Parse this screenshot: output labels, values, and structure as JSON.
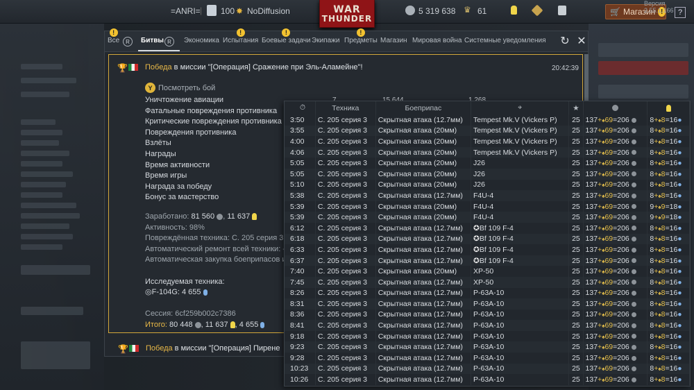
{
  "topbar": {
    "squad_tag": "=ANRI=",
    "level": "100",
    "nickname": "NoDiffusion",
    "logo_line1": "WAR",
    "logo_line2": "THUNDER",
    "silver_lions": "5 319 638",
    "golden_eagles": "61",
    "shop_label": "Магазин",
    "help_label": "?",
    "version": "Версия 2.55.1.166"
  },
  "tabs": {
    "items": [
      "Все",
      "Битвы",
      "Экономика",
      "Испытания",
      "Боевые задачи",
      "Экипажи",
      "Предметы",
      "Магазин",
      "Мировая война",
      "Системные уведомления"
    ],
    "active": "Битвы"
  },
  "message": {
    "victory": "Победа",
    "mission_text": " в миссии \"[Операция] Сражение при Эль-Аламейне\"!",
    "time": "20:42:39",
    "watch_battle": "Посмотреть бой",
    "stat_labels": [
      "Уничтожение авиации",
      "Фатальные повреждения противника",
      "Критические повреждения противника",
      "Повреждения противника",
      "Взлёты",
      "Награды",
      "Время активности",
      "Время игры",
      "Награда за победу",
      "Бонус за мастерство"
    ],
    "first_row_values": [
      "7",
      "15 644",
      "1 268"
    ],
    "earned_label": "Заработано: ",
    "earned_sl": "81 560",
    "earned_rp": "11 637",
    "activity": "Активность: 98%",
    "damaged_vehicles": "Повреждённая техника: C. 205 серия 3",
    "auto_repair": "Автоматический ремонт всей техники: -",
    "auto_ammo": "Автоматическая закупка боеприпасов и",
    "researched_label": "Исследуемая техника:",
    "researched_vehicle": "F-104G: 4 655",
    "session": "Сессия: 6cf259b002c7386",
    "total_label": "Итого:",
    "total_value_sl": " 80 448",
    "total_value_rp": ", 11 637",
    "total_value_rp2": ", 4 655"
  },
  "message2": {
    "victory": "Победа",
    "mission_text": " в миссии \"[Операция] Пирене"
  },
  "table": {
    "headers": {
      "vehicle": "Техника",
      "ammo": "Боеприпас"
    },
    "rows": [
      {
        "time": "3:50",
        "veh": "C. 205 серия 3",
        "ammo": "Скрытная атака (12.7мм)",
        "target": "Tempest Mk.V (Vickers P)",
        "ger": false,
        "br": "25",
        "sl1": "137",
        "sl2": "69",
        "sl3": "206",
        "rp1": "8",
        "rp2": "8",
        "rp3": "16"
      },
      {
        "time": "3:55",
        "veh": "C. 205 серия 3",
        "ammo": "Скрытная атака (20мм)",
        "target": "Tempest Mk.V (Vickers P)",
        "ger": false,
        "br": "25",
        "sl1": "137",
        "sl2": "69",
        "sl3": "206",
        "rp1": "8",
        "rp2": "8",
        "rp3": "16"
      },
      {
        "time": "4:00",
        "veh": "C. 205 серия 3",
        "ammo": "Скрытная атака (20мм)",
        "target": "Tempest Mk.V (Vickers P)",
        "ger": false,
        "br": "25",
        "sl1": "137",
        "sl2": "69",
        "sl3": "206",
        "rp1": "8",
        "rp2": "8",
        "rp3": "16"
      },
      {
        "time": "4:06",
        "veh": "C. 205 серия 3",
        "ammo": "Скрытная атака (20мм)",
        "target": "Tempest Mk.V (Vickers P)",
        "ger": false,
        "br": "25",
        "sl1": "137",
        "sl2": "69",
        "sl3": "206",
        "rp1": "8",
        "rp2": "8",
        "rp3": "16"
      },
      {
        "time": "5:05",
        "veh": "C. 205 серия 3",
        "ammo": "Скрытная атака (20мм)",
        "target": "J26",
        "ger": false,
        "br": "25",
        "sl1": "137",
        "sl2": "69",
        "sl3": "206",
        "rp1": "8",
        "rp2": "8",
        "rp3": "16"
      },
      {
        "time": "5:05",
        "veh": "C. 205 серия 3",
        "ammo": "Скрытная атака (20мм)",
        "target": "J26",
        "ger": false,
        "br": "25",
        "sl1": "137",
        "sl2": "69",
        "sl3": "206",
        "rp1": "8",
        "rp2": "8",
        "rp3": "16"
      },
      {
        "time": "5:10",
        "veh": "C. 205 серия 3",
        "ammo": "Скрытная атака (20мм)",
        "target": "J26",
        "ger": false,
        "br": "25",
        "sl1": "137",
        "sl2": "69",
        "sl3": "206",
        "rp1": "8",
        "rp2": "8",
        "rp3": "16"
      },
      {
        "time": "5:38",
        "veh": "C. 205 серия 3",
        "ammo": "Скрытная атака (12.7мм)",
        "target": "F4U-4",
        "ger": false,
        "br": "25",
        "sl1": "137",
        "sl2": "69",
        "sl3": "206",
        "rp1": "8",
        "rp2": "8",
        "rp3": "16"
      },
      {
        "time": "5:39",
        "veh": "C. 205 серия 3",
        "ammo": "Скрытная атака (20мм)",
        "target": "F4U-4",
        "ger": false,
        "br": "25",
        "sl1": "137",
        "sl2": "69",
        "sl3": "206",
        "rp1": "9",
        "rp2": "9",
        "rp3": "18"
      },
      {
        "time": "5:39",
        "veh": "C. 205 серия 3",
        "ammo": "Скрытная атака (20мм)",
        "target": "F4U-4",
        "ger": false,
        "br": "25",
        "sl1": "137",
        "sl2": "69",
        "sl3": "206",
        "rp1": "9",
        "rp2": "9",
        "rp3": "18"
      },
      {
        "time": "6:12",
        "veh": "C. 205 серия 3",
        "ammo": "Скрытная атака (12.7мм)",
        "target": "Bf 109 F-4",
        "ger": true,
        "br": "25",
        "sl1": "137",
        "sl2": "69",
        "sl3": "206",
        "rp1": "8",
        "rp2": "8",
        "rp3": "16"
      },
      {
        "time": "6:18",
        "veh": "C. 205 серия 3",
        "ammo": "Скрытная атака (12.7мм)",
        "target": "Bf 109 F-4",
        "ger": true,
        "br": "25",
        "sl1": "137",
        "sl2": "69",
        "sl3": "206",
        "rp1": "8",
        "rp2": "8",
        "rp3": "16"
      },
      {
        "time": "6:33",
        "veh": "C. 205 серия 3",
        "ammo": "Скрытная атака (12.7мм)",
        "target": "Bf 109 F-4",
        "ger": true,
        "br": "25",
        "sl1": "137",
        "sl2": "69",
        "sl3": "206",
        "rp1": "8",
        "rp2": "8",
        "rp3": "16"
      },
      {
        "time": "6:37",
        "veh": "C. 205 серия 3",
        "ammo": "Скрытная атака (12.7мм)",
        "target": "Bf 109 F-4",
        "ger": true,
        "br": "25",
        "sl1": "137",
        "sl2": "69",
        "sl3": "206",
        "rp1": "8",
        "rp2": "8",
        "rp3": "16"
      },
      {
        "time": "7:40",
        "veh": "C. 205 серия 3",
        "ammo": "Скрытная атака (20мм)",
        "target": "XP-50",
        "ger": false,
        "br": "25",
        "sl1": "137",
        "sl2": "69",
        "sl3": "206",
        "rp1": "8",
        "rp2": "8",
        "rp3": "16"
      },
      {
        "time": "7:45",
        "veh": "C. 205 серия 3",
        "ammo": "Скрытная атака (12.7мм)",
        "target": "XP-50",
        "ger": false,
        "br": "25",
        "sl1": "137",
        "sl2": "69",
        "sl3": "206",
        "rp1": "8",
        "rp2": "8",
        "rp3": "16"
      },
      {
        "time": "8:26",
        "veh": "C. 205 серия 3",
        "ammo": "Скрытная атака (12.7мм)",
        "target": "P-63A-10",
        "ger": false,
        "br": "25",
        "sl1": "137",
        "sl2": "69",
        "sl3": "206",
        "rp1": "8",
        "rp2": "8",
        "rp3": "16"
      },
      {
        "time": "8:31",
        "veh": "C. 205 серия 3",
        "ammo": "Скрытная атака (12.7мм)",
        "target": "P-63A-10",
        "ger": false,
        "br": "25",
        "sl1": "137",
        "sl2": "69",
        "sl3": "206",
        "rp1": "8",
        "rp2": "8",
        "rp3": "16"
      },
      {
        "time": "8:36",
        "veh": "C. 205 серия 3",
        "ammo": "Скрытная атака (12.7мм)",
        "target": "P-63A-10",
        "ger": false,
        "br": "25",
        "sl1": "137",
        "sl2": "69",
        "sl3": "206",
        "rp1": "8",
        "rp2": "8",
        "rp3": "16"
      },
      {
        "time": "8:41",
        "veh": "C. 205 серия 3",
        "ammo": "Скрытная атака (12.7мм)",
        "target": "P-63A-10",
        "ger": false,
        "br": "25",
        "sl1": "137",
        "sl2": "69",
        "sl3": "206",
        "rp1": "8",
        "rp2": "8",
        "rp3": "16"
      },
      {
        "time": "9:18",
        "veh": "C. 205 серия 3",
        "ammo": "Скрытная атака (12.7мм)",
        "target": "P-63A-10",
        "ger": false,
        "br": "25",
        "sl1": "137",
        "sl2": "69",
        "sl3": "206",
        "rp1": "8",
        "rp2": "8",
        "rp3": "16"
      },
      {
        "time": "9:23",
        "veh": "C. 205 серия 3",
        "ammo": "Скрытная атака (12.7мм)",
        "target": "P-63A-10",
        "ger": false,
        "br": "25",
        "sl1": "137",
        "sl2": "69",
        "sl3": "206",
        "rp1": "8",
        "rp2": "8",
        "rp3": "16"
      },
      {
        "time": "9:28",
        "veh": "C. 205 серия 3",
        "ammo": "Скрытная атака (12.7мм)",
        "target": "P-63A-10",
        "ger": false,
        "br": "25",
        "sl1": "137",
        "sl2": "69",
        "sl3": "206",
        "rp1": "8",
        "rp2": "8",
        "rp3": "16"
      },
      {
        "time": "10:23",
        "veh": "C. 205 серия 3",
        "ammo": "Скрытная атака (12.7мм)",
        "target": "P-63A-10",
        "ger": false,
        "br": "25",
        "sl1": "137",
        "sl2": "69",
        "sl3": "206",
        "rp1": "8",
        "rp2": "8",
        "rp3": "16"
      },
      {
        "time": "10:26",
        "veh": "C. 205 серия 3",
        "ammo": "Скрытная атака (12.7мм)",
        "target": "P-63A-10",
        "ger": false,
        "br": "25",
        "sl1": "137",
        "sl2": "69",
        "sl3": "206",
        "rp1": "8",
        "rp2": "8",
        "rp3": "16"
      }
    ]
  },
  "colors": {
    "gold_border": "#d4a83a",
    "victory": "#e9b948",
    "rp_blue": "#7fb0e6",
    "bulb_yellow": "#f0d54a"
  },
  "icons": {
    "time_col": "stopwatch-icon",
    "target_col": "crosshair-icon",
    "br_col": "star-icon",
    "sl_col": "silver-lion-icon",
    "rp_col": "bulb-icon",
    "reload": "refresh-icon",
    "close": "close-icon"
  }
}
